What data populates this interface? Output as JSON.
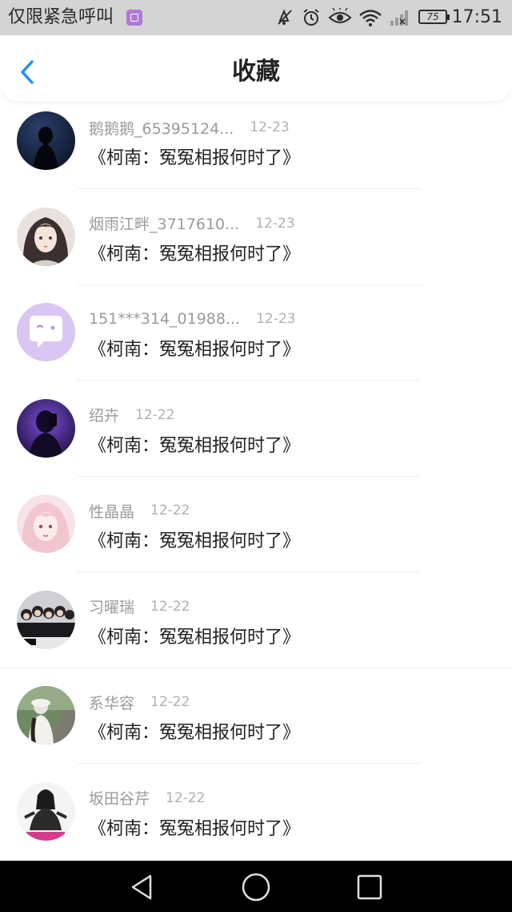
{
  "status_bar": {
    "carrier": "仅限紧急呼叫",
    "battery": "75",
    "time": "17:51",
    "icons": [
      "carrier-app-icon",
      "mute-icon",
      "alarm-icon",
      "eye-comfort-icon",
      "wifi-icon",
      "signal-icon",
      "battery-icon"
    ]
  },
  "header": {
    "title": "收藏",
    "back_icon": "chevron-left-icon",
    "accent": "#1e90ff"
  },
  "items": [
    {
      "name": "鹅鹅鹅_65395124...",
      "date": "12-23",
      "content": "《柯南：冤冤相报何时了》",
      "avatar": "dark-silhouette-avatar"
    },
    {
      "name": "烟雨江畔_3717610...",
      "date": "12-23",
      "content": "《柯南：冤冤相报何时了》",
      "avatar": "anime-girl-avatar"
    },
    {
      "name": "151***314_01988...",
      "date": "12-23",
      "content": "《柯南：冤冤相报何时了》",
      "avatar": "default-chat-avatar"
    },
    {
      "name": "绍卉",
      "date": "12-22",
      "content": "《柯南：冤冤相报何时了》",
      "avatar": "purple-selfie-avatar"
    },
    {
      "name": "性晶晶",
      "date": "12-22",
      "content": "《柯南：冤冤相报何时了》",
      "avatar": "pink-anime-avatar"
    },
    {
      "name": "习曜瑞",
      "date": "12-22",
      "content": "《柯南：冤冤相报何时了》",
      "avatar": "group-photo-avatar"
    },
    {
      "name": "系华容",
      "date": "12-22",
      "content": "《柯南：冤冤相报何时了》",
      "avatar": "outdoor-girl-avatar"
    },
    {
      "name": "坂田谷芹",
      "date": "12-22",
      "content": "《柯南：冤冤相报何时了》",
      "avatar": "bw-portrait-avatar"
    }
  ],
  "nav_bar": {
    "back": "nav-back-icon",
    "home": "nav-home-icon",
    "recents": "nav-recents-icon"
  }
}
